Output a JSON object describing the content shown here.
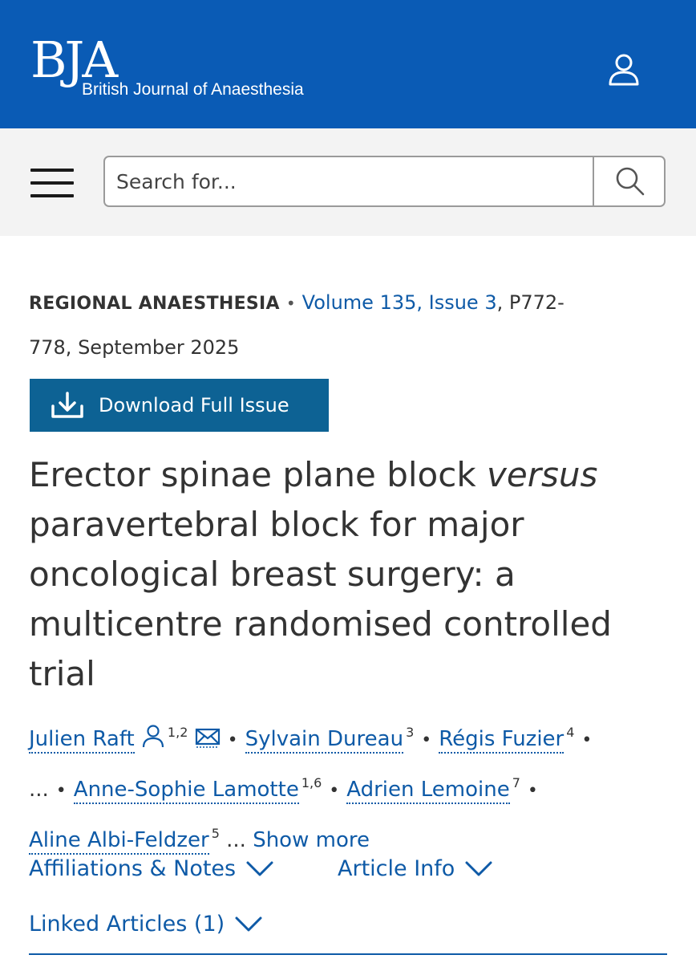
{
  "header": {
    "logo_mark": "BJA",
    "logo_subtitle": "British Journal of Anaesthesia",
    "brand_color": "#0a5bb5",
    "account_icon": "user-icon"
  },
  "search": {
    "placeholder": "Search for...",
    "menu_icon": "hamburger-menu-icon",
    "submit_icon": "search-icon"
  },
  "article": {
    "section": "REGIONAL ANAESTHESIA",
    "volume_issue": "Volume 135, Issue 3",
    "pages_date": ", P772-778, September 2025",
    "download_label": "Download Full Issue",
    "title_part1": "Erector spinae plane block ",
    "title_italic": "versus",
    "title_part2": " paravertebral block for major oncological breast surgery: a multicentre randomised controlled trial"
  },
  "authors": [
    {
      "name": "Julien Raft",
      "sup": "1,2"
    },
    {
      "name": "Sylvain Dureau",
      "sup": "3"
    },
    {
      "name": "Régis Fuzier",
      "sup": "4"
    },
    {
      "name": "Anne-Sophie Lamotte",
      "sup": "1,6"
    },
    {
      "name": "Adrien Lemoine",
      "sup": "7"
    },
    {
      "name": "Aline Albi-Feldzer",
      "sup": "5"
    }
  ],
  "authors_ellipsis": "...",
  "show_more_label": "Show more",
  "expanders": {
    "affiliations": "Affiliations & Notes",
    "article_info": "Article Info",
    "linked_articles": "Linked Articles (1)"
  }
}
